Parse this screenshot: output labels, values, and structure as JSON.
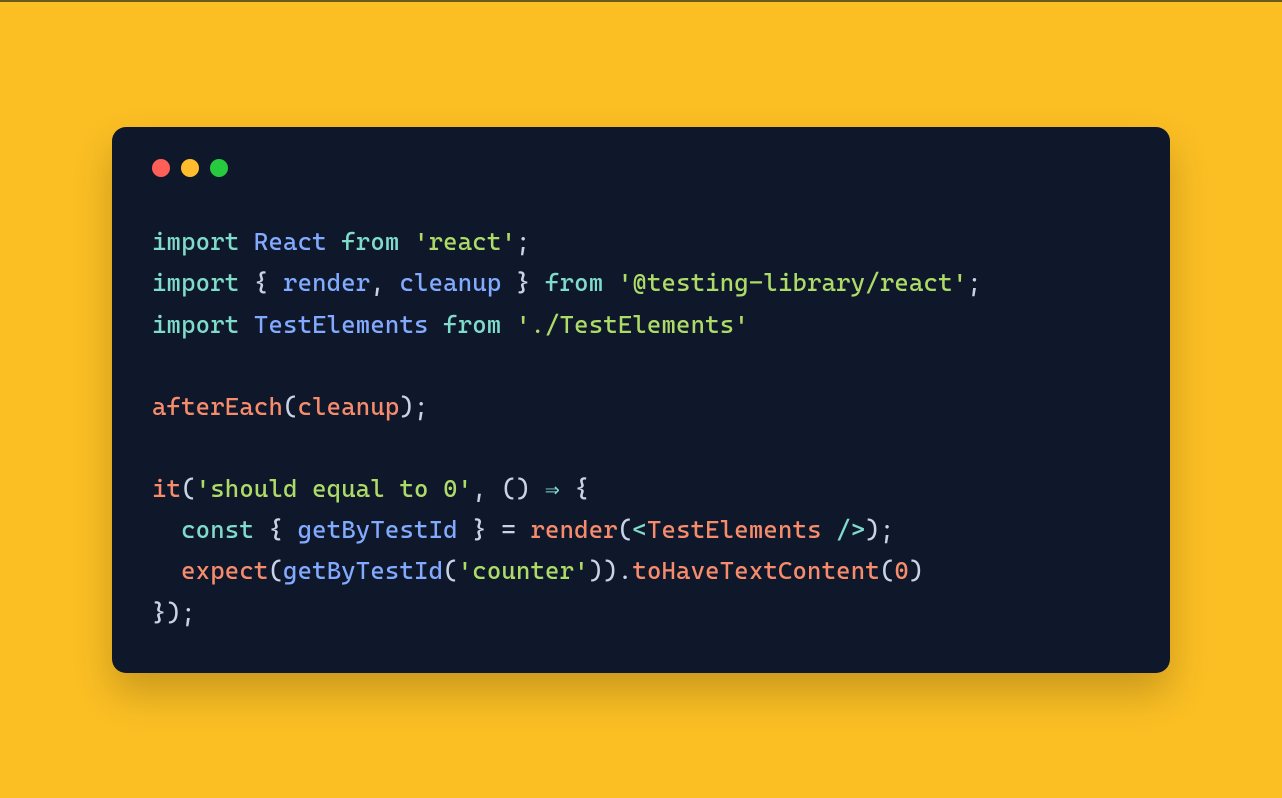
{
  "colors": {
    "background": "#fbbf24",
    "editor_bg": "#0f172a",
    "traffic_red": "#ff5f56",
    "traffic_yellow": "#ffbd2e",
    "traffic_green": "#27c93f"
  },
  "code": {
    "tokens": [
      [
        {
          "t": "import",
          "c": "kw-import"
        },
        {
          "t": " ",
          "c": "punct"
        },
        {
          "t": "React",
          "c": "ident"
        },
        {
          "t": " ",
          "c": "punct"
        },
        {
          "t": "from",
          "c": "kw-import"
        },
        {
          "t": " ",
          "c": "punct"
        },
        {
          "t": "'react'",
          "c": "str"
        },
        {
          "t": ";",
          "c": "punct"
        }
      ],
      [
        {
          "t": "import",
          "c": "kw-import"
        },
        {
          "t": " { ",
          "c": "punct"
        },
        {
          "t": "render",
          "c": "ident"
        },
        {
          "t": ", ",
          "c": "punct"
        },
        {
          "t": "cleanup",
          "c": "ident"
        },
        {
          "t": " } ",
          "c": "punct"
        },
        {
          "t": "from",
          "c": "kw-import"
        },
        {
          "t": " ",
          "c": "punct"
        },
        {
          "t": "'@testing-library/react'",
          "c": "str"
        },
        {
          "t": ";",
          "c": "punct"
        }
      ],
      [
        {
          "t": "import",
          "c": "kw-import"
        },
        {
          "t": " ",
          "c": "punct"
        },
        {
          "t": "TestElements",
          "c": "ident"
        },
        {
          "t": " ",
          "c": "punct"
        },
        {
          "t": "from",
          "c": "kw-import"
        },
        {
          "t": " ",
          "c": "punct"
        },
        {
          "t": "'./TestElements'",
          "c": "str"
        }
      ],
      [],
      [
        {
          "t": "afterEach",
          "c": "fn-orange"
        },
        {
          "t": "(",
          "c": "punct"
        },
        {
          "t": "cleanup",
          "c": "fn-orange"
        },
        {
          "t": ");",
          "c": "punct"
        }
      ],
      [],
      [
        {
          "t": "it",
          "c": "fn-orange"
        },
        {
          "t": "(",
          "c": "punct"
        },
        {
          "t": "'should equal to 0'",
          "c": "str"
        },
        {
          "t": ", () ",
          "c": "punct"
        },
        {
          "t": "⇒",
          "c": "kw-import"
        },
        {
          "t": " {",
          "c": "punct"
        }
      ],
      [
        {
          "t": "  ",
          "c": "punct"
        },
        {
          "t": "const",
          "c": "kw-decl"
        },
        {
          "t": " { ",
          "c": "punct"
        },
        {
          "t": "getByTestId",
          "c": "ident"
        },
        {
          "t": " } = ",
          "c": "punct"
        },
        {
          "t": "render",
          "c": "fn-orange"
        },
        {
          "t": "(",
          "c": "punct"
        },
        {
          "t": "<",
          "c": "jsx-tag"
        },
        {
          "t": "TestElements",
          "c": "jsx-name"
        },
        {
          "t": " />",
          "c": "jsx-tag"
        },
        {
          "t": ");",
          "c": "punct"
        }
      ],
      [
        {
          "t": "  ",
          "c": "punct"
        },
        {
          "t": "expect",
          "c": "fn-orange"
        },
        {
          "t": "(",
          "c": "punct"
        },
        {
          "t": "getByTestId",
          "c": "ident"
        },
        {
          "t": "(",
          "c": "punct"
        },
        {
          "t": "'counter'",
          "c": "str"
        },
        {
          "t": ")).",
          "c": "punct"
        },
        {
          "t": "toHaveTextContent",
          "c": "fn-orange"
        },
        {
          "t": "(",
          "c": "punct"
        },
        {
          "t": "0",
          "c": "num"
        },
        {
          "t": ")",
          "c": "punct"
        }
      ],
      [
        {
          "t": "});",
          "c": "punct"
        }
      ]
    ]
  }
}
